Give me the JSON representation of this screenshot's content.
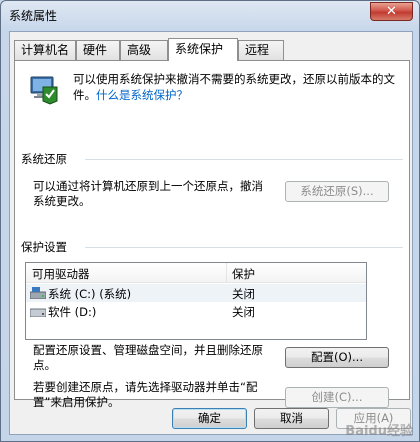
{
  "window": {
    "title": "系统属性",
    "close_label": "✕"
  },
  "tabs": [
    {
      "label": "计算机名",
      "active": false
    },
    {
      "label": "硬件",
      "active": false
    },
    {
      "label": "高级",
      "active": false
    },
    {
      "label": "系统保护",
      "active": true
    },
    {
      "label": "远程",
      "active": false
    }
  ],
  "intro": {
    "text": "可以使用系统保护来撤消不需要的系统更改，还原以前版本的文件。",
    "link": "什么是系统保护？"
  },
  "restore": {
    "group_title": "系统还原",
    "description": "可以通过将计算机还原到上一个还原点，撤消系统更改。",
    "button": "系统还原(S)..."
  },
  "protection": {
    "group_title": "保护设置",
    "columns": [
      "可用驱动器",
      "保护"
    ],
    "drives": [
      {
        "name": "系统 (C:) (系统)",
        "status": "关闭",
        "icon": "system-drive-icon"
      },
      {
        "name": "软件 (D:)",
        "status": "关闭",
        "icon": "drive-icon"
      }
    ],
    "configure_text": "配置还原设置、管理磁盘空间，并且删除还原点。",
    "configure_button": "配置(O)...",
    "create_text": "若要创建还原点，请先选择驱动器并单击“配置”来启用保护。",
    "create_button": "创建(C)..."
  },
  "footer": {
    "ok": "确定",
    "cancel": "取消",
    "apply": "应用(A)"
  },
  "watermark": "Baidu经验"
}
